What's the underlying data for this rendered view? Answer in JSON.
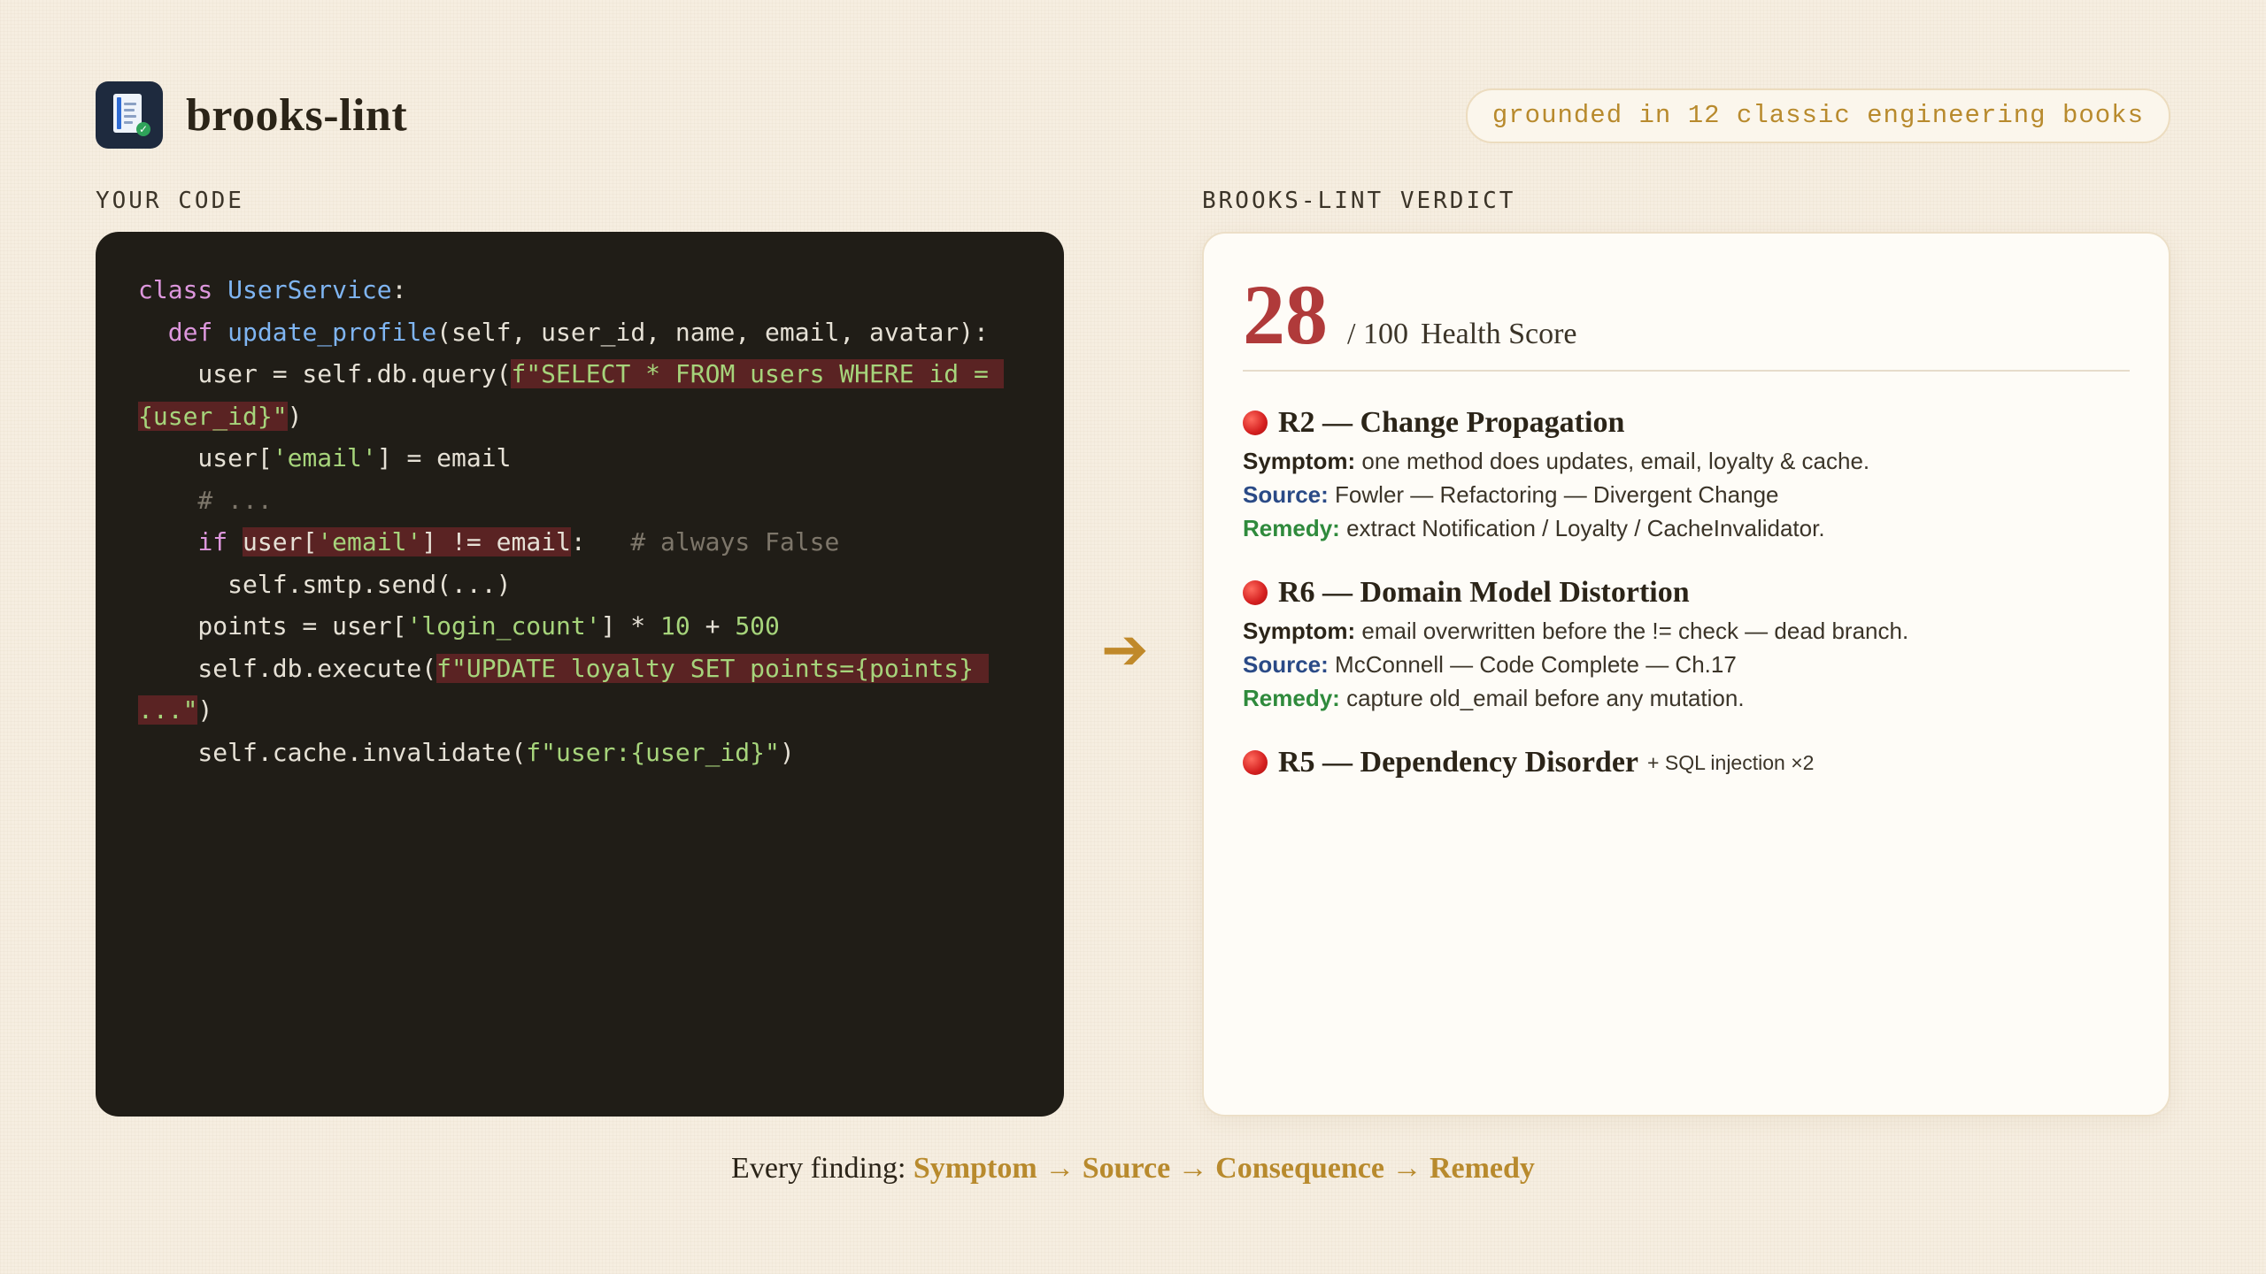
{
  "app": {
    "title": "brooks-lint",
    "badge": "grounded in 12 classic engineering books"
  },
  "code_section": {
    "label": "YOUR CODE",
    "lines": [
      [
        {
          "t": "class ",
          "c": "kw"
        },
        {
          "t": "UserService",
          "c": "cls"
        },
        {
          "t": ":",
          "c": ""
        }
      ],
      [
        {
          "t": "  ",
          "c": ""
        },
        {
          "t": "def ",
          "c": "kw"
        },
        {
          "t": "update_profile",
          "c": "cls"
        },
        {
          "t": "(self, user_id, name, email, avatar):",
          "c": ""
        }
      ],
      [
        {
          "t": "    user = self.db.query(",
          "c": ""
        },
        {
          "t": "f\"SELECT * FROM users WHERE id = ",
          "c": "str hl"
        }
      ],
      [
        {
          "t": "{user_id}\"",
          "c": "str hl"
        },
        {
          "t": ")",
          "c": ""
        }
      ],
      [
        {
          "t": "    user[",
          "c": ""
        },
        {
          "t": "'email'",
          "c": "str"
        },
        {
          "t": "] = email",
          "c": ""
        }
      ],
      [
        {
          "t": "    # ...",
          "c": "cmt"
        }
      ],
      [
        {
          "t": "    ",
          "c": ""
        },
        {
          "t": "if ",
          "c": "kw"
        },
        {
          "t": "user[",
          "c": "hl"
        },
        {
          "t": "'email'",
          "c": "str hl"
        },
        {
          "t": "] != email",
          "c": "hl"
        },
        {
          "t": ":   ",
          "c": ""
        },
        {
          "t": "# always False",
          "c": "cmt"
        }
      ],
      [
        {
          "t": "      self.smtp.send(...)",
          "c": ""
        }
      ],
      [
        {
          "t": "    points = user[",
          "c": ""
        },
        {
          "t": "'login_count'",
          "c": "str"
        },
        {
          "t": "] * ",
          "c": ""
        },
        {
          "t": "10",
          "c": "num"
        },
        {
          "t": " + ",
          "c": ""
        },
        {
          "t": "500",
          "c": "num"
        }
      ],
      [
        {
          "t": "    self.db.execute(",
          "c": ""
        },
        {
          "t": "f\"UPDATE loyalty SET points={points} ",
          "c": "str hl"
        }
      ],
      [
        {
          "t": "...\"",
          "c": "str hl"
        },
        {
          "t": ")",
          "c": ""
        }
      ],
      [
        {
          "t": "    self.cache.invalidate(",
          "c": ""
        },
        {
          "t": "f\"user:{user_id}\"",
          "c": "str"
        },
        {
          "t": ")",
          "c": ""
        }
      ]
    ]
  },
  "verdict": {
    "label": "BROOKS-LINT VERDICT",
    "score": "28",
    "score_out_of": "/ 100",
    "score_label": "Health Score",
    "findings": [
      {
        "title": "R2 — Change Propagation",
        "extra": "",
        "symptom_label": "Symptom:",
        "symptom": "one method does updates, email, loyalty & cache.",
        "source_label": "Source:",
        "source": "Fowler — Refactoring — Divergent Change",
        "remedy_label": "Remedy:",
        "remedy": "extract Notification / Loyalty / CacheInvalidator."
      },
      {
        "title": "R6 — Domain Model Distortion",
        "extra": "",
        "symptom_label": "Symptom:",
        "symptom": "email overwritten before the != check — dead branch.",
        "source_label": "Source:",
        "source": "McConnell — Code Complete — Ch.17",
        "remedy_label": "Remedy:",
        "remedy": "capture old_email before any mutation."
      },
      {
        "title": "R5 — Dependency Disorder",
        "extra": "+ SQL injection ×2"
      }
    ]
  },
  "footer": {
    "lead": "Every finding:",
    "steps": [
      "Symptom",
      "Source",
      "Consequence",
      "Remedy"
    ],
    "separator": "→"
  },
  "colors": {
    "background": "#f6eee1",
    "code_bg": "#201d17",
    "accent": "#b88a2d",
    "score": "#b03a3a",
    "source_label": "#2a4a86",
    "remedy_label": "#2f8a3c"
  },
  "icons": {
    "logo": "book-check-icon",
    "arrow": "arrow-right-icon",
    "severity": "red-circle-icon"
  }
}
